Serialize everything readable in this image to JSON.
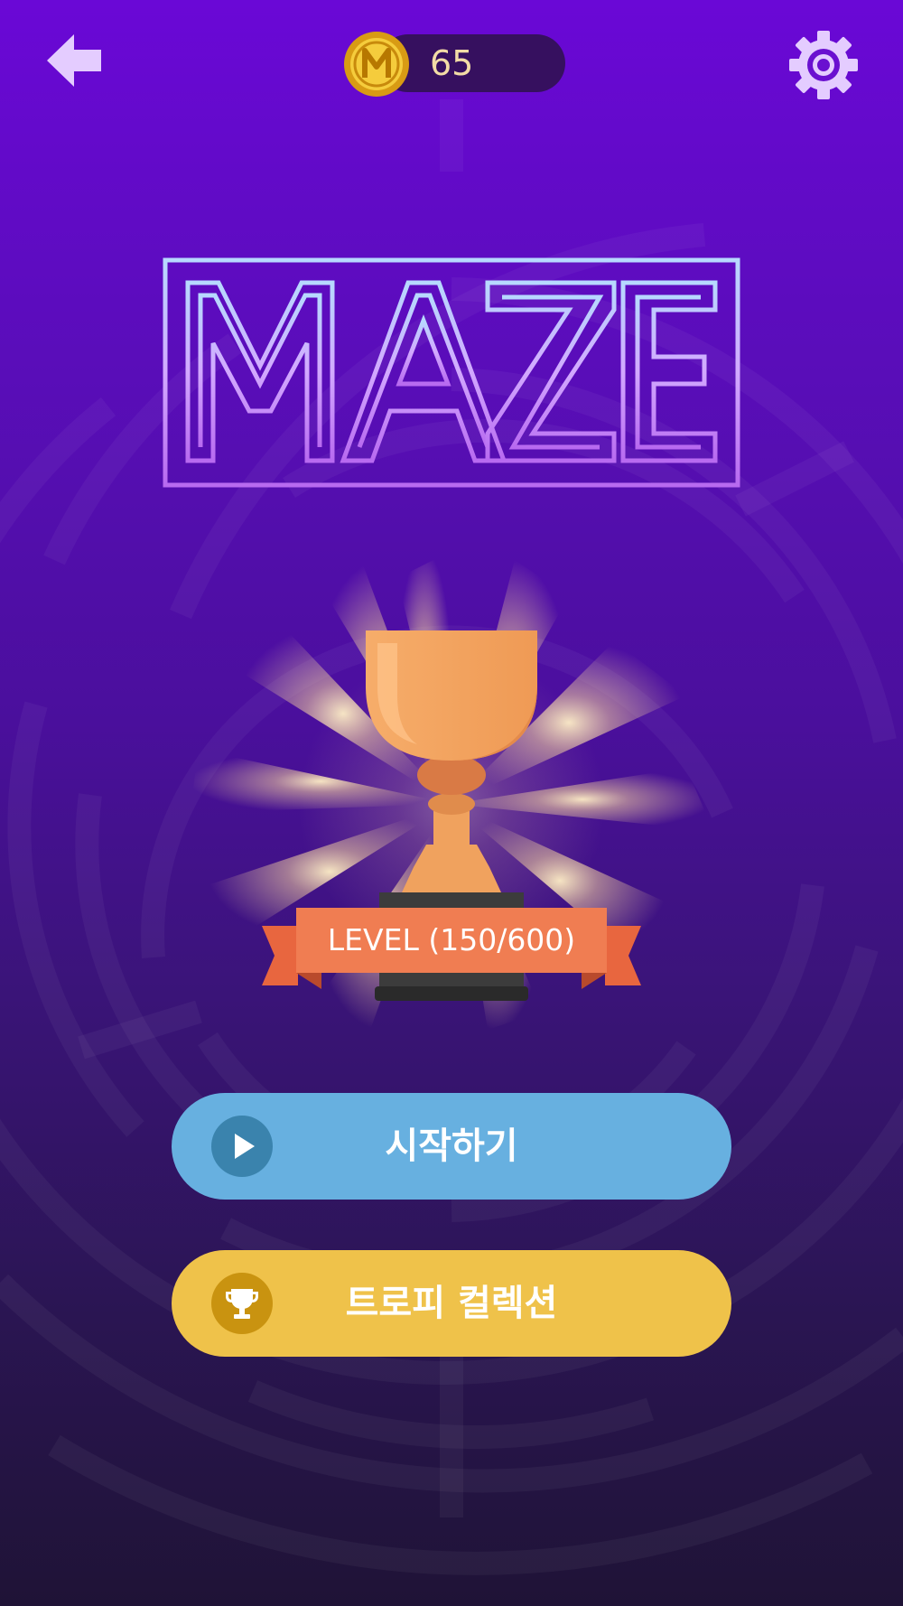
{
  "app": {
    "title": "MAZE"
  },
  "header": {
    "back_icon": "arrow-left-icon",
    "coin_icon": "m-coin-icon",
    "coin_count": "65",
    "settings_icon": "gear-icon"
  },
  "trophy": {
    "icon": "bronze-trophy-icon",
    "level_text": "LEVEL (150/600)"
  },
  "buttons": {
    "start_label": "시작하기",
    "start_icon": "play-icon",
    "trophy_label": "트로피 컬렉션",
    "trophy_icon": "trophy-icon"
  },
  "colors": {
    "background_top": "#6a08d6",
    "background_bottom": "#1f1336",
    "start_button": "#67b0e0",
    "trophy_button": "#efc24a",
    "banner": "#f07d52",
    "trophy": "#f0a25e"
  }
}
